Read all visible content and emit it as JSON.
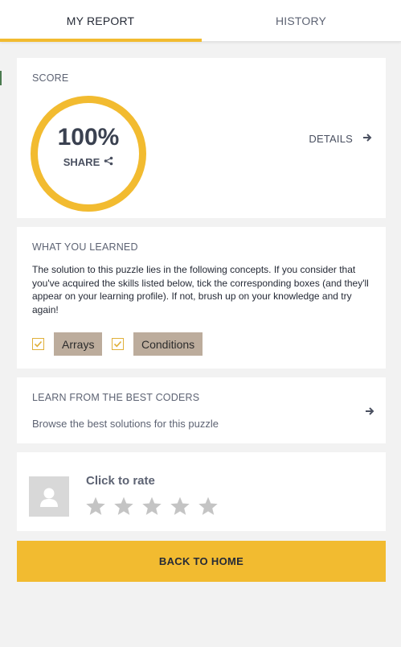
{
  "tabs": {
    "report": "MY REPORT",
    "history": "HISTORY"
  },
  "score": {
    "label": "SCORE",
    "value": "100%",
    "progress": 1.0,
    "share_label": "SHARE",
    "details_label": "DETAILS"
  },
  "learned": {
    "label": "WHAT YOU LEARNED",
    "description": "The solution to this puzzle lies in the following concepts. If you consider that you've acquired the skills listed below, tick the corresponding boxes (and they'll appear on your learning profile). If not, brush up on your knowledge and try again!",
    "concepts": [
      {
        "name": "Arrays",
        "checked": true
      },
      {
        "name": "Conditions",
        "checked": true
      }
    ]
  },
  "coders": {
    "label": "LEARN FROM THE BEST CODERS",
    "subtitle": "Browse the best solutions for this puzzle"
  },
  "rating": {
    "title": "Click to rate",
    "stars": 5,
    "filled": 0
  },
  "footer": {
    "back_label": "BACK TO HOME"
  },
  "colors": {
    "accent": "#f2bb30",
    "tag": "#bcac9c",
    "star": "#c4c4c4"
  },
  "icons": [
    "arrow-right-icon",
    "share-icon",
    "checkmark-icon",
    "user-icon",
    "star-icon"
  ]
}
